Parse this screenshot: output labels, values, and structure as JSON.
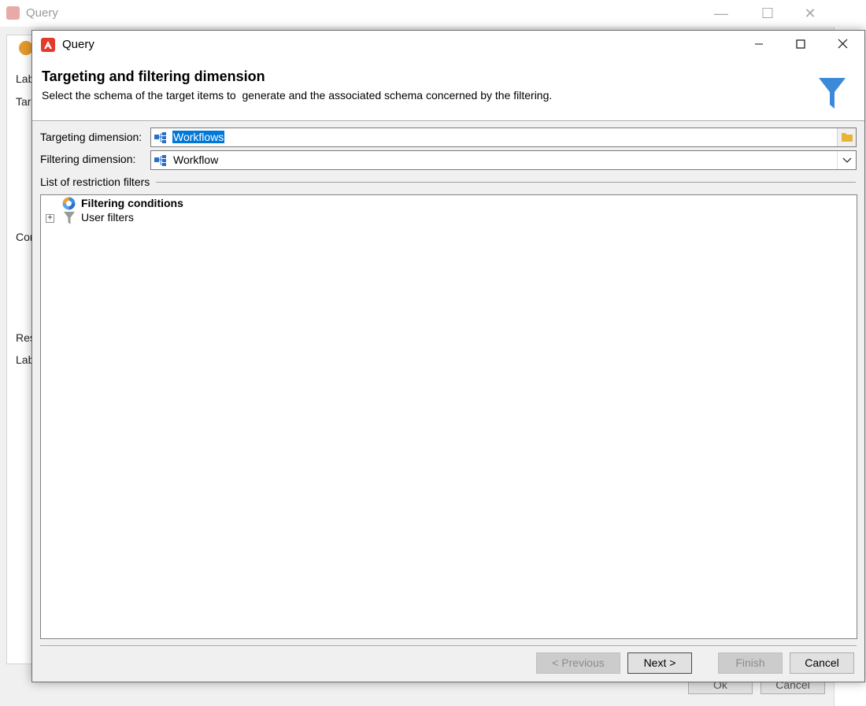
{
  "background_window": {
    "title": "Query",
    "labels": [
      "Lab",
      "Targ",
      "Cor",
      "Res",
      "Lab"
    ],
    "ok_label": "Ok",
    "cancel_label": "Cancel"
  },
  "dialog": {
    "title": "Query",
    "header": {
      "title": "Targeting and filtering dimension",
      "description": "Select the schema of the target items to  generate and the associated schema concerned by the filtering."
    },
    "targeting": {
      "label": "Targeting dimension:",
      "value": "Workflows"
    },
    "filtering": {
      "label": "Filtering dimension:",
      "value": "Workflow"
    },
    "restriction": {
      "label": "List of restriction filters",
      "items": [
        {
          "label": "Filtering conditions",
          "icon": "filtering-conditions-icon",
          "bold": true
        },
        {
          "label": "User filters",
          "icon": "funnel-icon",
          "bold": false
        }
      ]
    },
    "buttons": {
      "previous": "< Previous",
      "next": "Next >",
      "finish": "Finish",
      "cancel": "Cancel"
    }
  },
  "colors": {
    "accent": "#0078d7",
    "brand": "#e23a2c",
    "funnel": "#3b8ad9",
    "folder": "#e8b437"
  }
}
